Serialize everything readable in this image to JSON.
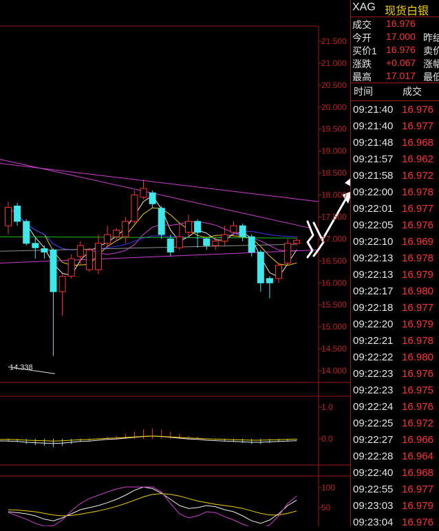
{
  "header": {
    "code": "XAG",
    "name": "现货白银"
  },
  "quote_rows": [
    {
      "label": "成交",
      "value": "16.976",
      "label2": ""
    },
    {
      "label": "今开",
      "value": "17.000",
      "label2": "昨结"
    },
    {
      "label": "买价1",
      "value": "16.976",
      "label2": "卖价"
    },
    {
      "label": "涨跌",
      "value": "+0.067",
      "label2": "涨幅"
    },
    {
      "label": "最高",
      "value": "17.017",
      "label2": "最低"
    }
  ],
  "trades_header": {
    "time": "时间",
    "price": "成交"
  },
  "trades": [
    {
      "time": "09:21:40",
      "price": "16.976"
    },
    {
      "time": "09:21:40",
      "price": "16.977"
    },
    {
      "time": "09:21:48",
      "price": "16.968"
    },
    {
      "time": "09:21:57",
      "price": "16.962"
    },
    {
      "time": "09:21:58",
      "price": "16.972"
    },
    {
      "time": "09:22:00",
      "price": "16.978"
    },
    {
      "time": "09:22:01",
      "price": "16.977"
    },
    {
      "time": "09:22:05",
      "price": "16.976"
    },
    {
      "time": "09:22:10",
      "price": "16.969"
    },
    {
      "time": "09:22:13",
      "price": "16.978"
    },
    {
      "time": "09:22:13",
      "price": "16.979"
    },
    {
      "time": "09:22:17",
      "price": "16.980"
    },
    {
      "time": "09:22:18",
      "price": "16.977"
    },
    {
      "time": "09:22:20",
      "price": "16.979"
    },
    {
      "time": "09:22:21",
      "price": "16.978"
    },
    {
      "time": "09:22:22",
      "price": "16.980"
    },
    {
      "time": "09:22:23",
      "price": "16.976"
    },
    {
      "time": "09:22:23",
      "price": "16.975"
    },
    {
      "time": "09:22:24",
      "price": "16.976"
    },
    {
      "time": "09:22:25",
      "price": "16.972"
    },
    {
      "time": "09:22:27",
      "price": "16.966"
    },
    {
      "time": "09:22:28",
      "price": "16.964"
    },
    {
      "time": "09:22:40",
      "price": "16.968"
    },
    {
      "time": "09:22:55",
      "price": "16.977"
    },
    {
      "time": "09:23:03",
      "price": "16.979"
    },
    {
      "time": "09:23:04",
      "price": "16.976"
    }
  ],
  "price_axis": [
    "21.500",
    "21.000",
    "20.500",
    "20.000",
    "19.500",
    "19.000",
    "18.500",
    "18.000",
    "17.500",
    "17.000",
    "16.500",
    "16.000",
    "15.500",
    "15.000",
    "14.500",
    "14.000"
  ],
  "low_annotation": "14.338",
  "macd_axis": [
    "1.0",
    "0.0"
  ],
  "kdj_axis": [
    "100",
    "50"
  ],
  "candles": [
    {
      "o": 17.3,
      "c": 17.72,
      "h": 17.85,
      "l": 17.1
    },
    {
      "o": 17.75,
      "c": 17.4,
      "h": 17.82,
      "l": 17.3
    },
    {
      "o": 17.4,
      "c": 16.9,
      "h": 17.45,
      "l": 16.85
    },
    {
      "o": 16.9,
      "c": 16.8,
      "h": 17.05,
      "l": 16.55
    },
    {
      "o": 16.78,
      "c": 16.7,
      "h": 16.85,
      "l": 16.55
    },
    {
      "o": 16.75,
      "c": 15.8,
      "h": 16.78,
      "l": 14.338
    },
    {
      "o": 15.8,
      "c": 16.15,
      "h": 16.2,
      "l": 15.25
    },
    {
      "o": 16.15,
      "c": 16.55,
      "h": 16.65,
      "l": 16.1
    },
    {
      "o": 16.6,
      "c": 16.85,
      "h": 16.95,
      "l": 16.4
    },
    {
      "o": 16.3,
      "c": 16.75,
      "h": 16.8,
      "l": 16.25
    },
    {
      "o": 16.3,
      "c": 16.9,
      "h": 17.1,
      "l": 16.2
    },
    {
      "o": 16.9,
      "c": 17.1,
      "h": 17.3,
      "l": 16.8
    },
    {
      "o": 17.05,
      "c": 17.2,
      "h": 17.25,
      "l": 16.95
    },
    {
      "o": 17.05,
      "c": 17.4,
      "h": 17.5,
      "l": 16.9
    },
    {
      "o": 17.4,
      "c": 18.0,
      "h": 18.1,
      "l": 17.35
    },
    {
      "o": 17.95,
      "c": 18.15,
      "h": 18.35,
      "l": 17.9
    },
    {
      "o": 18.05,
      "c": 17.8,
      "h": 18.1,
      "l": 17.7
    },
    {
      "o": 17.7,
      "c": 17.1,
      "h": 17.75,
      "l": 17.0
    },
    {
      "o": 17.0,
      "c": 16.7,
      "h": 17.1,
      "l": 16.6
    },
    {
      "o": 16.8,
      "c": 17.05,
      "h": 17.35,
      "l": 16.75
    },
    {
      "o": 17.15,
      "c": 17.4,
      "h": 17.55,
      "l": 17.05
    },
    {
      "o": 17.4,
      "c": 17.15,
      "h": 17.45,
      "l": 16.8
    },
    {
      "o": 17.0,
      "c": 16.85,
      "h": 17.05,
      "l": 16.75
    },
    {
      "o": 16.85,
      "c": 16.95,
      "h": 17.05,
      "l": 16.75
    },
    {
      "o": 16.95,
      "c": 17.1,
      "h": 17.3,
      "l": 16.85
    },
    {
      "o": 17.15,
      "c": 17.3,
      "h": 17.4,
      "l": 17.05
    },
    {
      "o": 17.3,
      "c": 17.05,
      "h": 17.35,
      "l": 16.95
    },
    {
      "o": 17.05,
      "c": 16.7,
      "h": 17.1,
      "l": 16.6
    },
    {
      "o": 16.7,
      "c": 16.0,
      "h": 16.75,
      "l": 15.8
    },
    {
      "o": 16.1,
      "c": 16.0,
      "h": 16.15,
      "l": 15.65
    },
    {
      "o": 16.1,
      "c": 16.4,
      "h": 16.45,
      "l": 16.0
    },
    {
      "o": 16.45,
      "c": 16.9,
      "h": 17.0,
      "l": 16.4
    },
    {
      "o": 16.9,
      "c": 16.97,
      "h": 17.05,
      "l": 16.85
    }
  ],
  "colors": {
    "up": "#ff3232",
    "down": "#40e8ec",
    "grid": "#a01818",
    "axis": "#c02020",
    "accent": "#f2d200"
  }
}
